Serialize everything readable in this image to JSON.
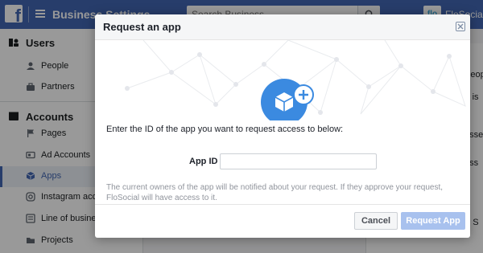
{
  "topbar": {
    "logo_letter": "f",
    "title": "Business Settings",
    "search_placeholder": "Search Business",
    "business_avatar_text": "flo",
    "business_name": "FloSocial"
  },
  "sidebar": {
    "users_section": "Users",
    "users_items": [
      "People",
      "Partners"
    ],
    "accounts_section": "Accounts",
    "accounts_items": [
      "Pages",
      "Ad Accounts",
      "Apps",
      "Instagram accounts",
      "Line of business",
      "Projects"
    ],
    "selected_item": "Apps"
  },
  "background": {
    "fragments": [
      "Peop",
      "ts is",
      "asse",
      "ass",
      "to S"
    ]
  },
  "modal": {
    "title": "Request an app",
    "intro": "Enter the ID of the app you want to request access to below:",
    "field_label": "App ID",
    "field_value": "",
    "field_placeholder": "",
    "note": "The current owners of the app will be notified about your request. If they approve your request, FloSocial will have access to it.",
    "cancel_label": "Cancel",
    "submit_label": "Request App"
  },
  "colors": {
    "brand": "#4267b2",
    "hero_icon": "#3b8ae0",
    "submit_disabled": "#a8c1ee"
  },
  "icons": {
    "close": "close-icon",
    "search": "search-icon",
    "app": "cube-icon",
    "add": "plus-icon"
  }
}
